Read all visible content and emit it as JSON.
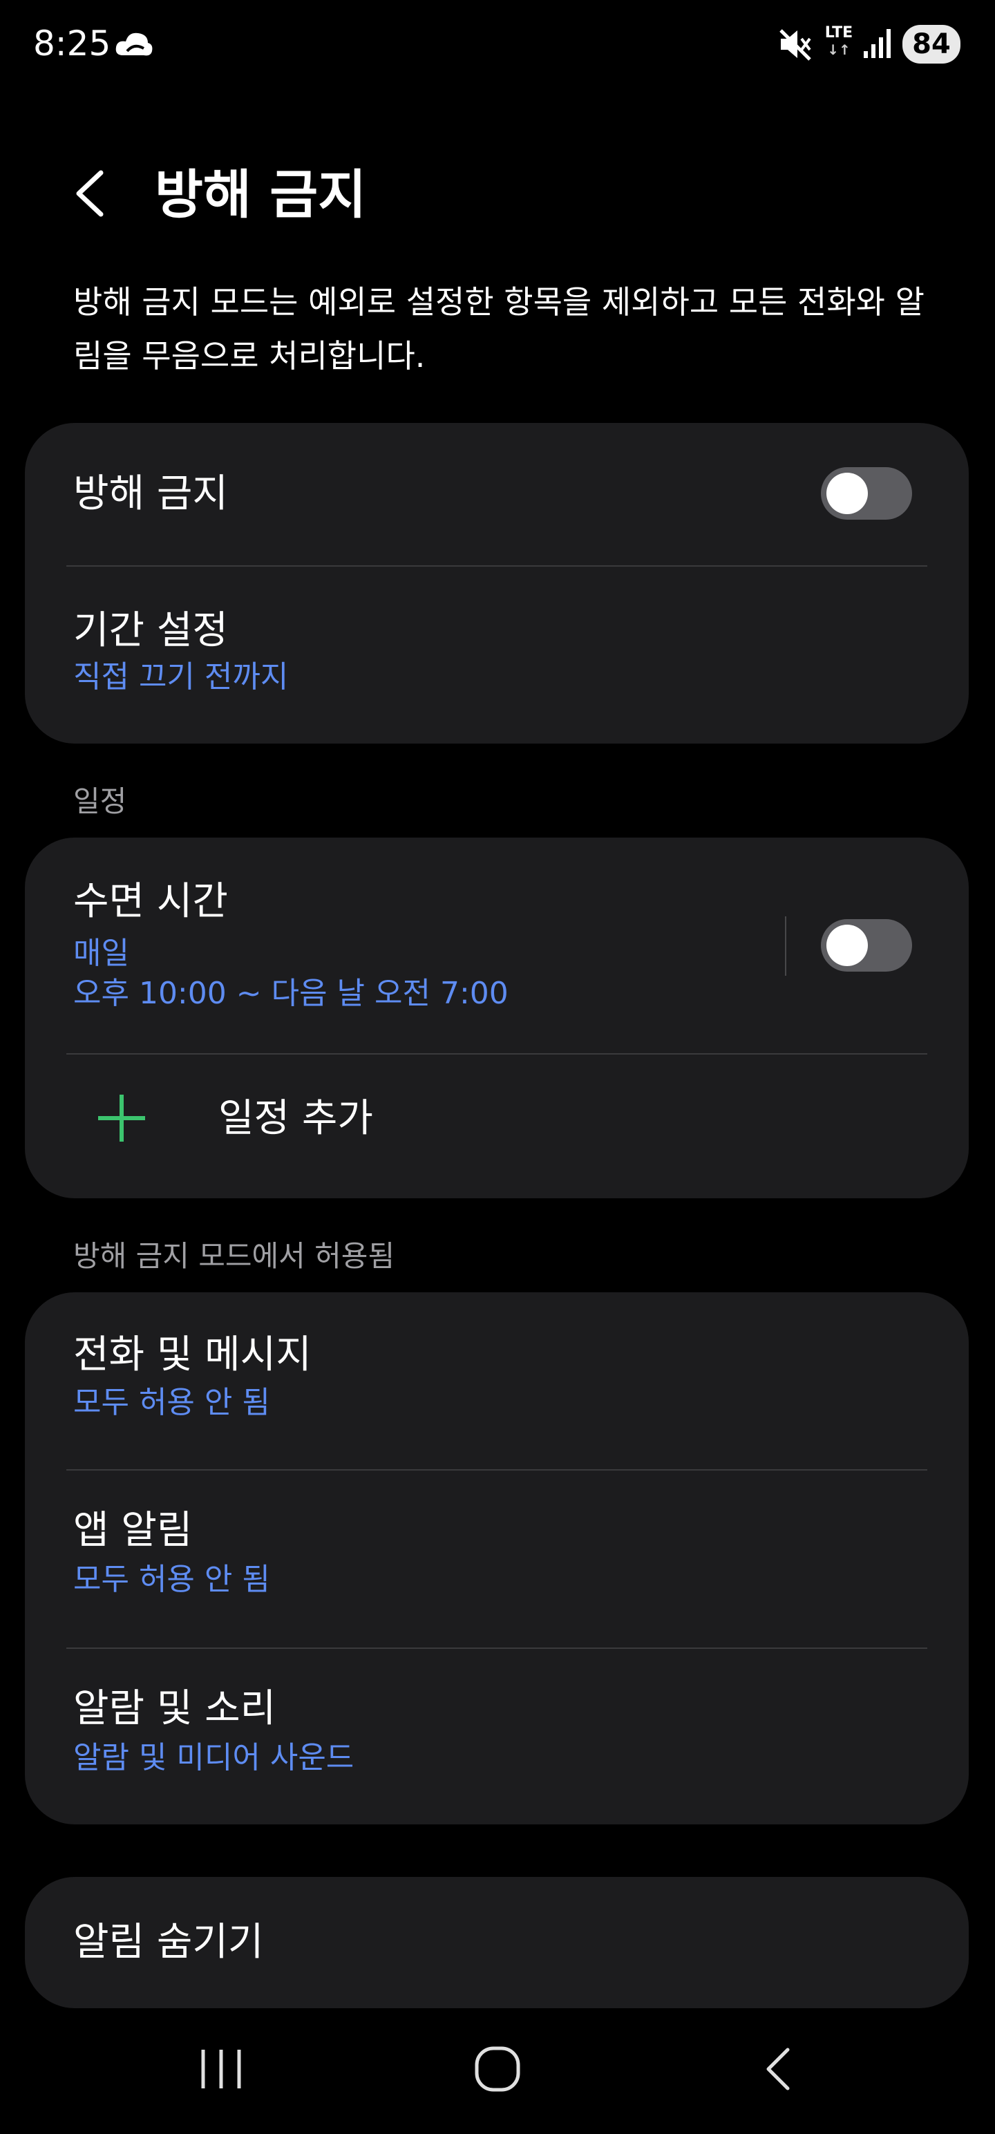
{
  "status_bar": {
    "time": "8:25",
    "network": "LTE",
    "network_arrows": "↓↑",
    "battery": "84",
    "icons": [
      "cloud-icon",
      "mute-icon",
      "signal-icon"
    ]
  },
  "header": {
    "back_icon": "back-chevron-icon",
    "title": "방해 금지"
  },
  "description": "방해 금지 모드는 예외로 설정한 항목을 제외하고 모든 전화와 알림을 무음으로 처리합니다.",
  "main_card": {
    "dnd_label": "방해 금지",
    "dnd_enabled": false,
    "duration_title": "기간 설정",
    "duration_value": "직접 끄기 전까지"
  },
  "schedule_section": {
    "label": "일정",
    "sleep_title": "수면 시간",
    "sleep_days": "매일",
    "sleep_time": "오후 10:00 ~ 다음 날 오전 7:00",
    "sleep_enabled": false,
    "add_schedule_label": "일정 추가"
  },
  "allowed_section": {
    "label": "방해 금지 모드에서 허용됨",
    "items": [
      {
        "title": "전화 및 메시지",
        "value": "모두 허용 안 됨"
      },
      {
        "title": "앱 알림",
        "value": "모두 허용 안 됨"
      },
      {
        "title": "알람 및 소리",
        "value": "알람 및 미디어 사운드"
      }
    ]
  },
  "hide_card": {
    "title": "알림 숨기기"
  },
  "colors": {
    "background": "#000000",
    "card": "#1c1c1e",
    "accent_blue": "#5e8cf2",
    "plus_green": "#3cc46e",
    "toggle_off": "#5c5c60"
  }
}
